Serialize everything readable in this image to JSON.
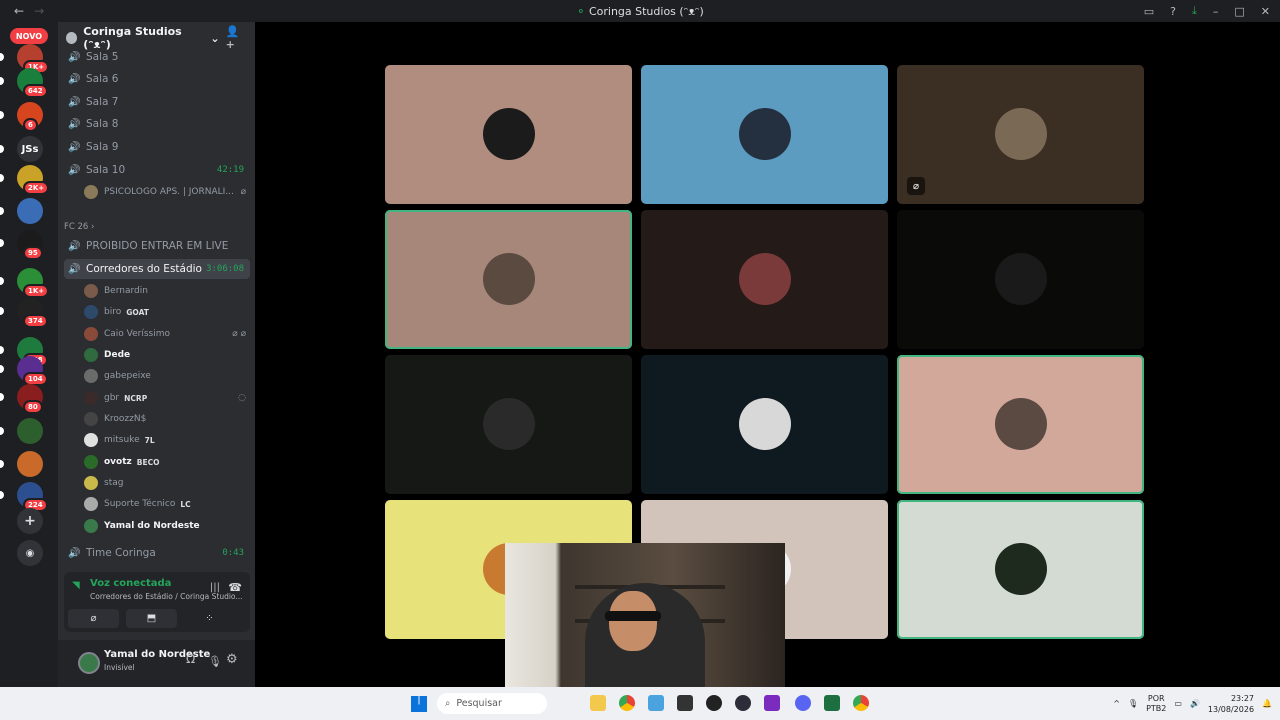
{
  "window": {
    "title": "Coringa Studios (ᵔᴥᵔ)",
    "back_icon": "arrow-left-icon",
    "forward_icon": "arrow-right-icon"
  },
  "guilds": {
    "novo_badge": "NOVO",
    "items": [
      {
        "badge": "1K+",
        "color": "#b5402f"
      },
      {
        "badge": "642",
        "color": "#1a7f3c"
      },
      {
        "badge": "6",
        "color": "#d6451e"
      },
      {
        "label": "JSs",
        "color": "#313338"
      },
      {
        "badge": "2K+",
        "color": "#c9a227"
      },
      {
        "badge": "",
        "color": "#3a6db5"
      },
      {
        "badge": "95",
        "color": "#1b1b1b"
      },
      {
        "badge": "1K+",
        "color": "#2a8f36"
      },
      {
        "badge": "374",
        "color": "#222"
      },
      {
        "badge": "128",
        "color": "#1f7b3d"
      },
      {
        "badge": "104",
        "color": "#5a2d91"
      },
      {
        "badge": "80",
        "color": "#8a1d1d"
      },
      {
        "badge": "",
        "color": "#2c5e2e"
      },
      {
        "badge": "",
        "color": "#c96a2b"
      },
      {
        "badge": "224",
        "color": "#2c4f8f"
      }
    ]
  },
  "server": {
    "name": "Coringa Studios (ᵔᴥᵔ)",
    "channels_top": [
      {
        "name": "Sala 5"
      },
      {
        "name": "Sala 6"
      },
      {
        "name": "Sala 7"
      },
      {
        "name": "Sala 8"
      },
      {
        "name": "Sala 9"
      },
      {
        "name": "Sala 10",
        "time": "42:19"
      }
    ],
    "sala10_member": "PSICOLOGO APS. | JORNALI...",
    "category": "FC 26",
    "proibido": "PROIBIDO ENTRAR EM LIVE",
    "active_channel": {
      "name": "Corredores do Estádio",
      "time": "3:06:08"
    },
    "members": [
      {
        "name": "Bernardin",
        "tag": "",
        "color": "#7a5a4a"
      },
      {
        "name": "biro",
        "tag": "GOAT",
        "color": "#2e4a6b"
      },
      {
        "name": "Caio Veríssimo",
        "tag": "",
        "color": "#8a4a3a"
      },
      {
        "name": "Dede",
        "tag": "",
        "color": "#2f6b3f"
      },
      {
        "name": "gabepeixe",
        "tag": "",
        "color": "#6b6b6b"
      },
      {
        "name": "gbr",
        "tag": "NCRP",
        "color": "#3a2a2a"
      },
      {
        "name": "KroozzN$",
        "tag": "",
        "color": "#444"
      },
      {
        "name": "mitsuke",
        "tag": "7L",
        "color": "#e0e0e0"
      },
      {
        "name": "ovotz",
        "tag": "BECO",
        "color": "#2a6b2a"
      },
      {
        "name": "stag",
        "tag": "",
        "color": "#c9b84a"
      },
      {
        "name": "Suporte Técnico",
        "tag": "LC",
        "color": "#aaa"
      },
      {
        "name": "Yamal do Nordeste",
        "tag": "",
        "color": "#3a7a4a"
      }
    ],
    "time_coringa": {
      "name": "Time Coringa",
      "time": "0:43"
    }
  },
  "voice": {
    "status": "Voz conectada",
    "location": "Corredores do Estádio / Coringa Studio..."
  },
  "user": {
    "name": "Yamal do Nordeste",
    "status": "Invisível"
  },
  "tiles": [
    {
      "bg": "#b08d7e",
      "avatar": "#1b1b1b",
      "speaking": false,
      "muted": false
    },
    {
      "bg": "#5b9cc0",
      "avatar": "#243040",
      "speaking": false,
      "muted": false
    },
    {
      "bg": "#3b2e22",
      "avatar": "#7a6a55",
      "speaking": false,
      "muted": true
    },
    {
      "bg": "#a7877a",
      "avatar": "#5a4a40",
      "speaking": true,
      "muted": false
    },
    {
      "bg": "#241a18",
      "avatar": "#7a3a3a",
      "speaking": false,
      "muted": false
    },
    {
      "bg": "#0a0a09",
      "avatar": "#1a1a1a",
      "speaking": false,
      "muted": false
    },
    {
      "bg": "#151815",
      "avatar": "#2a2a2a",
      "speaking": false,
      "muted": false
    },
    {
      "bg": "#0f1a20",
      "avatar": "#d8d8d8",
      "speaking": false,
      "muted": false
    },
    {
      "bg": "#d1a89a",
      "avatar": "#5a4a42",
      "speaking": true,
      "muted": false
    },
    {
      "bg": "#e8e27a",
      "avatar": "#c87a30",
      "speaking": false,
      "muted": false
    },
    {
      "bg": "#d2c4ba",
      "avatar": "#f0f0f0",
      "speaking": false,
      "muted": false
    },
    {
      "bg": "#d3dbd2",
      "avatar": "#1e2a1e",
      "speaking": true,
      "muted": false
    }
  ],
  "taskbar": {
    "search_placeholder": "Pesquisar",
    "lang_top": "POR",
    "lang_bottom": "PTB2",
    "time": "23:27",
    "date": "13/08/2026"
  }
}
